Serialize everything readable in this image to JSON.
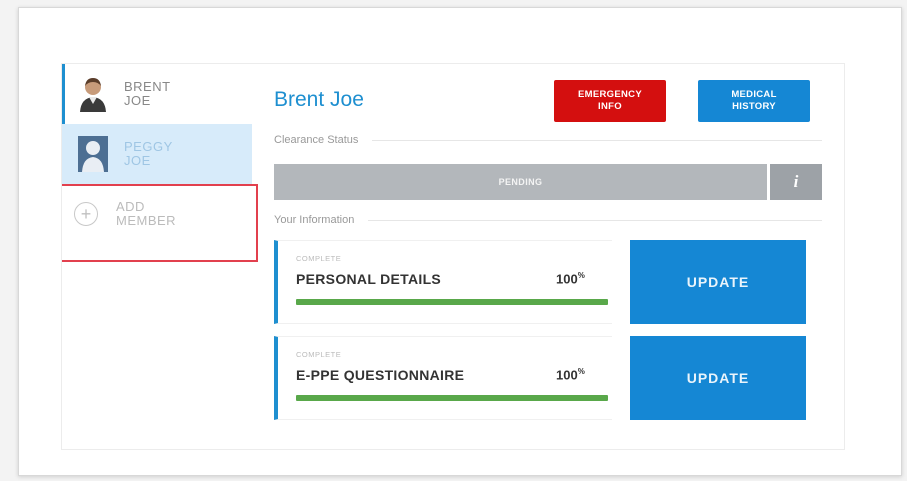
{
  "sidebar": {
    "members": [
      {
        "name": "BRENT\nJOE",
        "active": true
      },
      {
        "name": "PEGGY\nJOE",
        "active": false
      }
    ],
    "add_member": {
      "label": "ADD\nMEMBER",
      "icon": "plus-circle-icon"
    }
  },
  "header": {
    "name": "Brent Joe",
    "emergency_label": "EMERGENCY\nINFO",
    "medical_label": "MEDICAL\nHISTORY"
  },
  "clearance": {
    "section_label": "Clearance Status",
    "status": "PENDING",
    "info_glyph": "i"
  },
  "info": {
    "section_label": "Your Information",
    "cards": [
      {
        "state": "COMPLETE",
        "title": "PERSONAL DETAILS",
        "percent": "100",
        "percent_suffix": "%",
        "progress": 1.0,
        "button": "UPDATE"
      },
      {
        "state": "COMPLETE",
        "title": "E-PPE QUESTIONNAIRE",
        "percent": "100",
        "percent_suffix": "%",
        "progress": 1.0,
        "button": "UPDATE"
      }
    ]
  },
  "colors": {
    "accent": "#1e8fd0",
    "emergency": "#d40f0f",
    "highlight": "#e2404e",
    "progress": "#59a84a",
    "pending": "#b3b7bb"
  }
}
